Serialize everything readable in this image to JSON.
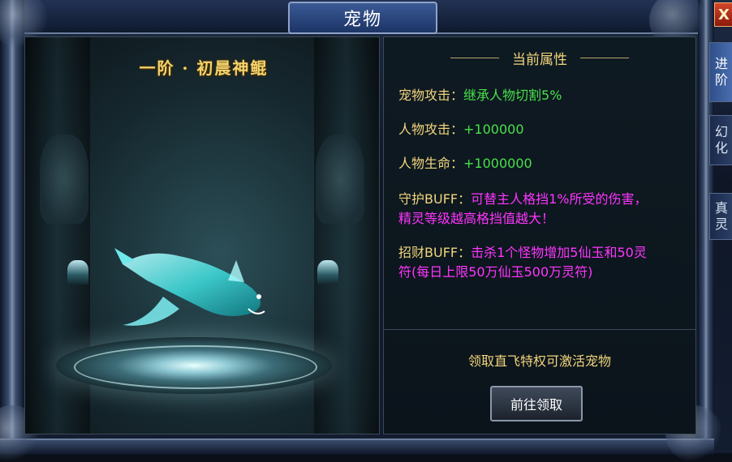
{
  "window": {
    "title": "宠物",
    "close_label": "X"
  },
  "side_tabs": [
    {
      "label_top": "进",
      "label_bottom": "阶",
      "active": true
    },
    {
      "label_top": "幻",
      "label_bottom": "化",
      "active": false
    },
    {
      "label_top": "真",
      "label_bottom": "灵",
      "active": false
    }
  ],
  "pet": {
    "name": "一阶 · 初晨神鲲"
  },
  "attributes": {
    "header": "当前属性",
    "pet_attack": {
      "label": "宠物攻击：",
      "value": "继承人物切割5%"
    },
    "char_attack": {
      "label": "人物攻击：",
      "value": "+100000"
    },
    "char_hp": {
      "label": "人物生命：",
      "value": "+1000000"
    },
    "guard_buff": {
      "label": "守护BUFF：",
      "value_line1": "可替主人格挡1%所受的伤害，",
      "value_line2": "精灵等级越高格挡值越大！"
    },
    "wealth_buff": {
      "label": "招财BUFF：",
      "value_line1": "击杀1个怪物增加5仙玉和50灵",
      "value_line2": "符(每日上限50万仙玉500万灵符)"
    }
  },
  "activation": {
    "text": "领取直飞特权可激活宠物",
    "button_label": "前往领取"
  },
  "colors": {
    "label_gold": "#f2d57c",
    "value_green": "#4ae04a",
    "value_pink": "#ff35ff"
  }
}
